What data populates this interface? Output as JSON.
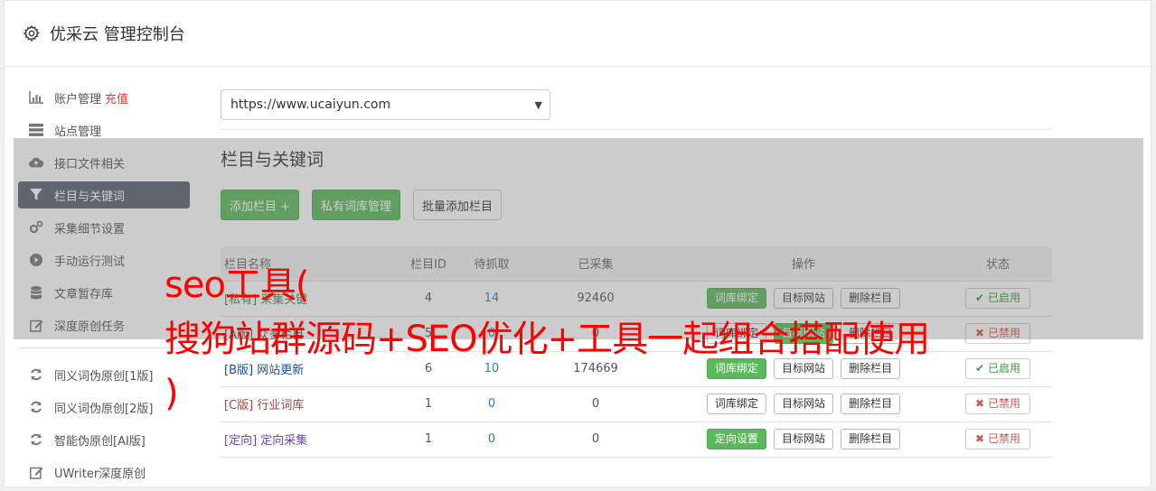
{
  "header": {
    "title": "优采云 管理控制台",
    "icon": "gear-icon"
  },
  "sidebar": {
    "items": [
      {
        "label": "账户管理",
        "icon": "bar-chart-icon",
        "extra": "充值"
      },
      {
        "label": "站点管理",
        "icon": "server-icon"
      },
      {
        "label": "接口文件相关",
        "icon": "cloud-upload-icon"
      },
      {
        "label": "栏目与关键词",
        "icon": "filter-icon",
        "active": true
      },
      {
        "label": "采集细节设置",
        "icon": "gears-icon"
      },
      {
        "label": "手动运行测试",
        "icon": "play-icon"
      },
      {
        "label": "文章暂存库",
        "icon": "database-icon"
      },
      {
        "label": "深度原创任务",
        "icon": "edit-icon"
      }
    ],
    "tools": [
      {
        "label": "同义词伪原创[1版]",
        "icon": "refresh-icon"
      },
      {
        "label": "同义词伪原创[2版]",
        "icon": "refresh-icon"
      },
      {
        "label": "智能伪原创[AI版]",
        "icon": "refresh-icon"
      },
      {
        "label": "UWriter深度原创",
        "icon": "edit-icon"
      }
    ]
  },
  "main": {
    "site_select": {
      "value": "https://www.ucaiyun.com"
    },
    "section_title": "栏目与关键词",
    "buttons": {
      "add": "添加栏目 +",
      "private_lib": "私有词库管理",
      "batch_add": "批量添加栏目"
    },
    "table": {
      "headers": [
        "栏目名称",
        "栏目ID",
        "待抓取",
        "已采集",
        "操作",
        "状态"
      ],
      "rows": [
        {
          "tag": "[私有]",
          "name": "采集关键",
          "id": "4",
          "pending": "14",
          "collected": "92460",
          "op1": "词库绑定",
          "op2": "目标网站",
          "op3": "删除栏目",
          "status": "已启用"
        },
        {
          "tag": "[A版]",
          "name": "众多栏目",
          "id": "5",
          "pending": "0",
          "collected": "0",
          "op1": "词库绑定",
          "op2": "目标网站",
          "op3": "删除栏目",
          "status": "已禁用"
        },
        {
          "tag": "[B版]",
          "name": "网站更新",
          "id": "6",
          "pending": "10",
          "collected": "174669",
          "op1": "词库绑定",
          "op2": "目标网站",
          "op3": "删除栏目",
          "status": "已启用"
        },
        {
          "tag": "[C版]",
          "name": "行业词库",
          "id": "1",
          "pending": "0",
          "collected": "0",
          "op1": "词库绑定",
          "op2": "目标网站",
          "op3": "删除栏目",
          "status": "已禁用"
        },
        {
          "tag": "[定向]",
          "name": "定向采集",
          "id": "1",
          "pending": "0",
          "collected": "0",
          "op1": "定向设置",
          "op2": "目标网站",
          "op3": "删除栏目",
          "status": "已禁用"
        }
      ]
    }
  },
  "overlay_text": {
    "line1": "seo工具(",
    "line2": "搜狗站群源码+SEO优化+工具一起组合搭配使用",
    "line3": ")"
  }
}
